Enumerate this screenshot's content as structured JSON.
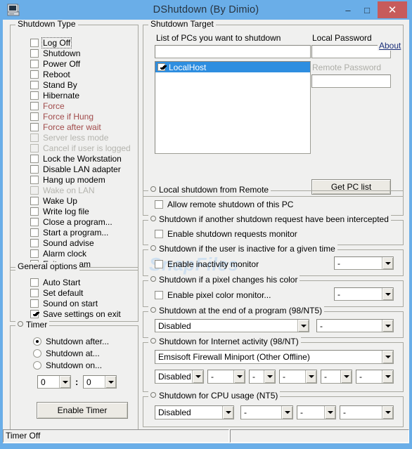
{
  "window": {
    "title": "DShutdown (By Dimio)",
    "icon": "computer-icon",
    "minimize": "–",
    "maximize": "□",
    "close": "✕",
    "titlebar_color": "#6aaee8",
    "close_color": "#c75b5b"
  },
  "watermark": "SnapFiles",
  "about_link": "About",
  "shutdown_type": {
    "title": "Shutdown Type",
    "items": [
      {
        "label": "Log Off",
        "checked": false,
        "state": "focused"
      },
      {
        "label": "Shutdown",
        "checked": false,
        "state": "normal"
      },
      {
        "label": "Power Off",
        "checked": false,
        "state": "normal"
      },
      {
        "label": "Reboot",
        "checked": false,
        "state": "normal"
      },
      {
        "label": "Stand By",
        "checked": false,
        "state": "normal"
      },
      {
        "label": "Hibernate",
        "checked": false,
        "state": "normal"
      },
      {
        "label": "Force",
        "checked": false,
        "state": "red"
      },
      {
        "label": "Force if Hung",
        "checked": false,
        "state": "red"
      },
      {
        "label": "Force after wait",
        "checked": false,
        "state": "red"
      },
      {
        "label": "Server less mode",
        "checked": false,
        "state": "disabled"
      },
      {
        "label": "Cancel if user is logged",
        "checked": false,
        "state": "disabled"
      },
      {
        "label": "Lock the Workstation",
        "checked": false,
        "state": "normal"
      },
      {
        "label": "Disable LAN adapter",
        "checked": false,
        "state": "normal"
      },
      {
        "label": "Hang up modem",
        "checked": false,
        "state": "normal"
      },
      {
        "label": "Wake on LAN",
        "checked": false,
        "state": "disabled"
      },
      {
        "label": "Wake Up",
        "checked": false,
        "state": "normal"
      },
      {
        "label": "Write log file",
        "checked": false,
        "state": "normal"
      },
      {
        "label": "Close a program...",
        "checked": false,
        "state": "normal"
      },
      {
        "label": "Start a program...",
        "checked": false,
        "state": "normal"
      },
      {
        "label": "Sound advise",
        "checked": false,
        "state": "normal"
      },
      {
        "label": "Alarm clock",
        "checked": false,
        "state": "normal"
      },
      {
        "label": "Exit program",
        "checked": false,
        "state": "normal"
      }
    ]
  },
  "general_options": {
    "title": "General options",
    "items": [
      {
        "label": "Auto Start",
        "checked": false
      },
      {
        "label": "Set default",
        "checked": false
      },
      {
        "label": "Sound on start",
        "checked": false
      },
      {
        "label": "Save settings on exit",
        "checked": true
      }
    ]
  },
  "timer": {
    "title": "Timer",
    "radios": [
      {
        "label": "Shutdown after...",
        "selected": true
      },
      {
        "label": "Shutdown at...",
        "selected": false
      },
      {
        "label": "Shutdown on...",
        "selected": false
      }
    ],
    "hours": "0",
    "separator": ":",
    "minutes": "0",
    "button": "Enable Timer"
  },
  "shutdown_target": {
    "title": "Shutdown Target",
    "list_label": "List of PCs you want to shutdown",
    "filter_value": "",
    "pc_items": [
      {
        "name": "LocalHost",
        "checked": true,
        "selected": true
      }
    ],
    "local_password_label": "Local Password",
    "local_password_value": "",
    "remote_password_label": "Remote Password",
    "remote_password_value": "",
    "get_pc_list_button": "Get PC list"
  },
  "local_remote": {
    "title": "Local shutdown from Remote",
    "checkbox": "Allow remote shutdown of this PC",
    "checked": false
  },
  "intercept": {
    "title": "Shutdown if another shutdown request have been intercepted",
    "checkbox": "Enable shutdown requests monitor",
    "checked": false
  },
  "inactivity": {
    "title": "Shutdown if the user is inactive for a given time",
    "checkbox": "Enable inactivity monitor",
    "checked": false,
    "combo": "-"
  },
  "pixel_color": {
    "title": "Shutdown if a pixel changes his color",
    "checkbox": "Enable pixel color monitor...",
    "checked": false,
    "combo": "-"
  },
  "end_of_program": {
    "title": "Shutdown at the end of a program (98/NT5)",
    "combo1": "Disabled",
    "combo2": "-"
  },
  "internet_activity": {
    "title": "Shutdown for Internet activity (98/NT)",
    "adapter": "Emsisoft Firewall Miniport (Other Offline)",
    "combos": [
      "Disabled",
      "-",
      "-",
      "-",
      "-",
      "-"
    ]
  },
  "cpu_usage": {
    "title": "Shutdown for CPU usage (NT5)",
    "combos": [
      "Disabled",
      "-",
      "-",
      "-"
    ]
  },
  "statusbar": {
    "left": "Timer Off",
    "right": ""
  }
}
